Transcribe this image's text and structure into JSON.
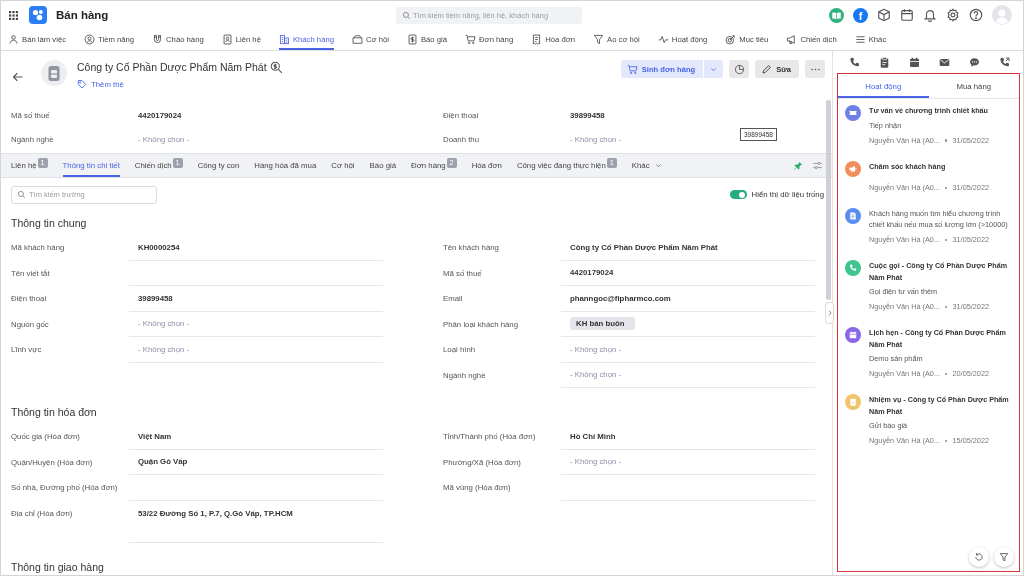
{
  "topbar": {
    "app_title": "Bán hàng",
    "search": {
      "placeholder": "Tìm kiếm tiềm năng, liên hệ, khách hàng"
    },
    "facebook_mark": "f"
  },
  "nav": [
    {
      "label": "Bàn làm việc",
      "selected": false
    },
    {
      "label": "Tiềm năng",
      "selected": false
    },
    {
      "label": "Chào hàng",
      "selected": false
    },
    {
      "label": "Liên hệ",
      "selected": false
    },
    {
      "label": "Khách hàng",
      "selected": true
    },
    {
      "label": "Cơ hội",
      "selected": false
    },
    {
      "label": "Báo giá",
      "selected": false
    },
    {
      "label": "Đơn hàng",
      "selected": false
    },
    {
      "label": "Hóa đơn",
      "selected": false
    },
    {
      "label": "Ao cơ hội",
      "selected": false
    },
    {
      "label": "Hoạt động",
      "selected": false
    },
    {
      "label": "Mục tiêu",
      "selected": false
    },
    {
      "label": "Chiến dịch",
      "selected": false
    },
    {
      "label": "Khác",
      "selected": false
    }
  ],
  "record": {
    "title": "Công ty Cổ Phần Dược Phẩm Năm Phát",
    "add_tag": "Thêm thẻ",
    "primary_action": "Sinh đơn hàng",
    "edit_action": "Sửa"
  },
  "summary": {
    "left": [
      {
        "label": "Mã số thuế",
        "kind": "text",
        "value": "4420179024"
      },
      {
        "label": "Ngành nghề",
        "kind": "text",
        "placeholder": "- Không chọn -"
      }
    ],
    "right": [
      {
        "label": "Điện thoại",
        "kind": "text",
        "value": "39899458"
      },
      {
        "label": "Doanh thu",
        "kind": "text",
        "placeholder": "- Không chọn -"
      }
    ]
  },
  "tooltip": "39899458",
  "detail_tabs": [
    {
      "label": "Liên hệ",
      "kind": "tab",
      "badge": "1",
      "selected": false
    },
    {
      "label": "Thông tin chi tiết",
      "kind": "tab",
      "selected": true
    },
    {
      "label": "Chiến dịch",
      "kind": "tab",
      "badge": "1",
      "selected": false
    },
    {
      "label": "Công ty con",
      "kind": "tab",
      "selected": false
    },
    {
      "label": "Hàng hóa đã mua",
      "kind": "tab",
      "selected": false
    },
    {
      "label": "Cơ hội",
      "kind": "tab",
      "selected": false
    },
    {
      "label": "Báo giá",
      "kind": "tab",
      "selected": false
    },
    {
      "label": "Đơn hàng",
      "kind": "tab",
      "badge": "2",
      "selected": false
    },
    {
      "label": "Hóa đơn",
      "kind": "tab",
      "selected": false
    },
    {
      "label": "Công việc đang thực hiện",
      "kind": "tab",
      "badge": "1",
      "selected": false
    },
    {
      "label": "Khác",
      "kind": "menu",
      "selected": false
    }
  ],
  "tabs_pinned": true,
  "field_search": {
    "placeholder": "Tìm kiếm trường"
  },
  "show_empty": {
    "label": "Hiển thị dữ liệu trống",
    "on": true
  },
  "sections": [
    {
      "title": "Thông tin chung",
      "left": [
        {
          "label": "Mã khách hàng",
          "kind": "text",
          "value": "KH0000254"
        },
        {
          "label": "Tên viết tắt",
          "kind": "text"
        },
        {
          "label": "Điện thoại",
          "kind": "text",
          "value": "39899458"
        },
        {
          "label": "Nguồn gốc",
          "kind": "text",
          "placeholder": "- Không chọn -"
        },
        {
          "label": "Lĩnh vực",
          "kind": "text",
          "placeholder": "- Không chọn -"
        }
      ],
      "right": [
        {
          "label": "Tên khách hàng",
          "kind": "text",
          "value": "Công ty Cổ Phần Dược Phẩm Năm Phát"
        },
        {
          "label": "Mã số thuế",
          "kind": "text",
          "value": "4420179024"
        },
        {
          "label": "Email",
          "kind": "text",
          "value": "phanngoc@fipharmco.com"
        },
        {
          "label": "Phân loại khách hàng",
          "kind": "tag",
          "value": "KH bán buôn"
        },
        {
          "label": "Loại hình",
          "kind": "text",
          "placeholder": "- Không chọn -"
        },
        {
          "label": "Ngành nghề",
          "kind": "text",
          "placeholder": "- Không chọn -"
        }
      ]
    },
    {
      "title": "Thông tin hóa đơn",
      "left": [
        {
          "label": "Quốc gia (Hóa đơn)",
          "kind": "text",
          "value": "Việt Nam"
        },
        {
          "label": "Quận/Huyện (Hóa đơn)",
          "kind": "text",
          "value": "Quận Gò Vấp"
        },
        {
          "label": "Số nhà, Đường phố (Hóa đơn)",
          "kind": "text"
        },
        {
          "label": "Địa chỉ (Hóa đơn)",
          "kind": "multiline",
          "value": "53/22 Đường Số 1, P.7, Q.Gò Vấp, TP.HCM"
        }
      ],
      "right": [
        {
          "label": "Tỉnh/Thành phố (Hóa đơn)",
          "kind": "text",
          "value": "Hồ Chí Minh"
        },
        {
          "label": "Phường/Xã (Hóa đơn)",
          "kind": "text",
          "placeholder": "- Không chọn -"
        },
        {
          "label": "Mã vùng (Hóa đơn)",
          "kind": "text"
        }
      ]
    },
    {
      "title": "Thông tin giao hàng"
    }
  ],
  "panel": {
    "highlighted": true,
    "tabs": [
      {
        "label": "Hoạt động",
        "selected": true
      },
      {
        "label": "Mua hàng",
        "selected": false
      }
    ],
    "activities": [
      {
        "kind": "consult",
        "color": "#6e7fe6",
        "title": "Tư vấn về chương trình chiết khấu",
        "note": "Tiếp nhận",
        "author": "Nguyễn Văn Hà (A0...",
        "date": "31/05/2022"
      },
      {
        "kind": "campaign",
        "color": "#f08f5b",
        "title": "Chăm sóc khách hàng",
        "author": "Nguyễn Văn Hà (A0...",
        "date": "31/05/2022"
      },
      {
        "kind": "note",
        "color": "#5b8df0",
        "note": "Khách hàng muốn tìm hiểu chương trình chiết khấu nếu mua số lượng lớn (>10000)",
        "author": "Nguyễn Văn Hà (A0...",
        "date": "31/05/2022"
      },
      {
        "kind": "call",
        "color": "#3ec48e",
        "title": "Cuộc gọi - Công ty Cổ Phần Dược Phẩm Năm Phát",
        "note": "Gọi điện tư vấn thêm",
        "author": "Nguyễn Văn Hà (A0...",
        "date": "31/05/2022"
      },
      {
        "kind": "appointment",
        "color": "#8a66e8",
        "title": "Lịch hẹn - Công ty Cổ Phần Dược Phẩm Năm Phát",
        "note": "Demo sản phẩm",
        "author": "Nguyễn Văn Hà (A0...",
        "date": "20/05/2022"
      },
      {
        "kind": "task",
        "color": "#f0c46c",
        "title": "Nhiệm vụ - Công ty Cổ Phần Dược Phẩm Năm Phát",
        "note": "Gửi báo giá",
        "author": "Nguyễn Văn Hà (A0...",
        "date": "15/05/2022"
      }
    ]
  }
}
